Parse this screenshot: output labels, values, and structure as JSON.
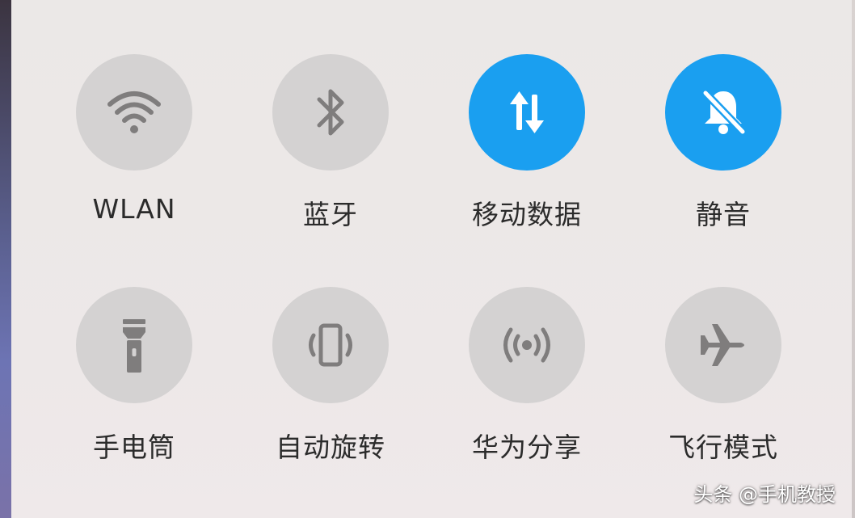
{
  "colors": {
    "active": "#1a9ff0",
    "inactive": "#d4d2d2",
    "icon_inactive": "#7f7d7d",
    "label": "#2b2b2b"
  },
  "toggles": [
    {
      "label": "WLAN",
      "icon": "wifi-icon",
      "active": false
    },
    {
      "label": "蓝牙",
      "icon": "bluetooth-icon",
      "active": false
    },
    {
      "label": "移动数据",
      "icon": "mobile-data-icon",
      "active": true
    },
    {
      "label": "静音",
      "icon": "bell-off-icon",
      "active": true
    },
    {
      "label": "手电筒",
      "icon": "flashlight-icon",
      "active": false
    },
    {
      "label": "自动旋转",
      "icon": "auto-rotate-icon",
      "active": false
    },
    {
      "label": "华为分享",
      "icon": "huawei-share-icon",
      "active": false
    },
    {
      "label": "飞行模式",
      "icon": "airplane-icon",
      "active": false
    }
  ],
  "watermark": "头条 @手机教授"
}
